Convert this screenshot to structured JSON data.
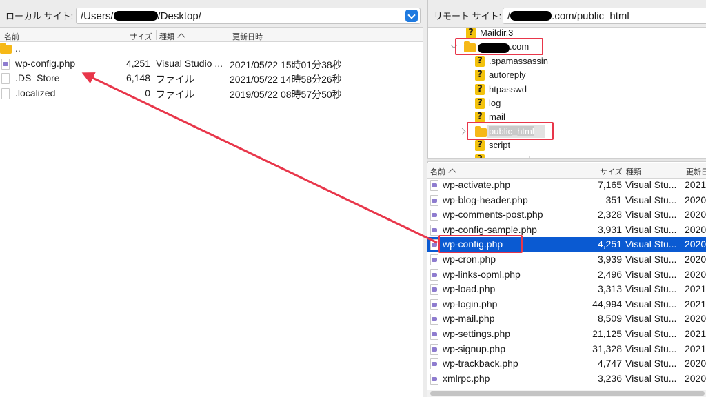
{
  "local": {
    "site_label": "ローカル サイト:",
    "path_prefix": "/Users/",
    "path_suffix": "/Desktop/",
    "columns": {
      "name": "名前",
      "size": "サイズ",
      "type": "種類",
      "modified": "更新日時"
    },
    "files": [
      {
        "name": "..",
        "size": "",
        "type": "",
        "modified": "",
        "icon": "folder-icon"
      },
      {
        "name": "wp-config.php",
        "size": "4,251",
        "type": "Visual Studio ...",
        "modified": "2021/05/22 15時01分38秒",
        "icon": "php-file-icon"
      },
      {
        "name": ".DS_Store",
        "size": "6,148",
        "type": "ファイル",
        "modified": "2021/05/22 14時58分26秒",
        "icon": "file-icon"
      },
      {
        "name": ".localized",
        "size": "0",
        "type": "ファイル",
        "modified": "2019/05/22 08時57分50秒",
        "icon": "file-icon"
      }
    ]
  },
  "remote": {
    "site_label": "リモート サイト:",
    "path_prefix": "/",
    "path_suffix": ".com/public_html",
    "tree": [
      {
        "label": "Maildir.3",
        "icon": "question-icon"
      },
      {
        "label": ".com",
        "icon": "folder-icon"
      },
      {
        "label": ".spamassassin",
        "icon": "question-icon"
      },
      {
        "label": "autoreply",
        "icon": "question-icon"
      },
      {
        "label": "htpasswd",
        "icon": "question-icon"
      },
      {
        "label": "log",
        "icon": "question-icon"
      },
      {
        "label": "mail",
        "icon": "question-icon"
      },
      {
        "label": "public_html",
        "icon": "folder-icon"
      },
      {
        "label": "script",
        "icon": "question-icon"
      },
      {
        "label": "xserver_php",
        "icon": "question-icon"
      }
    ],
    "columns": {
      "name": "名前",
      "size": "サイズ",
      "type": "種類",
      "modified": "更新日"
    },
    "files": [
      {
        "name": "wp-activate.php",
        "size": "7,165",
        "type": "Visual Stu...",
        "modified": "2021"
      },
      {
        "name": "wp-blog-header.php",
        "size": "351",
        "type": "Visual Stu...",
        "modified": "2020"
      },
      {
        "name": "wp-comments-post.php",
        "size": "2,328",
        "type": "Visual Stu...",
        "modified": "2020"
      },
      {
        "name": "wp-config-sample.php",
        "size": "3,931",
        "type": "Visual Stu...",
        "modified": "2020"
      },
      {
        "name": "wp-config.php",
        "size": "4,251",
        "type": "Visual Stu...",
        "modified": "2020",
        "selected": true
      },
      {
        "name": "wp-cron.php",
        "size": "3,939",
        "type": "Visual Stu...",
        "modified": "2020"
      },
      {
        "name": "wp-links-opml.php",
        "size": "2,496",
        "type": "Visual Stu...",
        "modified": "2020"
      },
      {
        "name": "wp-load.php",
        "size": "3,313",
        "type": "Visual Stu...",
        "modified": "2021"
      },
      {
        "name": "wp-login.php",
        "size": "44,994",
        "type": "Visual Stu...",
        "modified": "2021"
      },
      {
        "name": "wp-mail.php",
        "size": "8,509",
        "type": "Visual Stu...",
        "modified": "2020"
      },
      {
        "name": "wp-settings.php",
        "size": "21,125",
        "type": "Visual Stu...",
        "modified": "2021"
      },
      {
        "name": "wp-signup.php",
        "size": "31,328",
        "type": "Visual Stu...",
        "modified": "2021"
      },
      {
        "name": "wp-trackback.php",
        "size": "4,747",
        "type": "Visual Stu...",
        "modified": "2020"
      },
      {
        "name": "xmlrpc.php",
        "size": "3,236",
        "type": "Visual Stu...",
        "modified": "2020"
      }
    ]
  },
  "annotation": {
    "color": "#e8364a"
  }
}
